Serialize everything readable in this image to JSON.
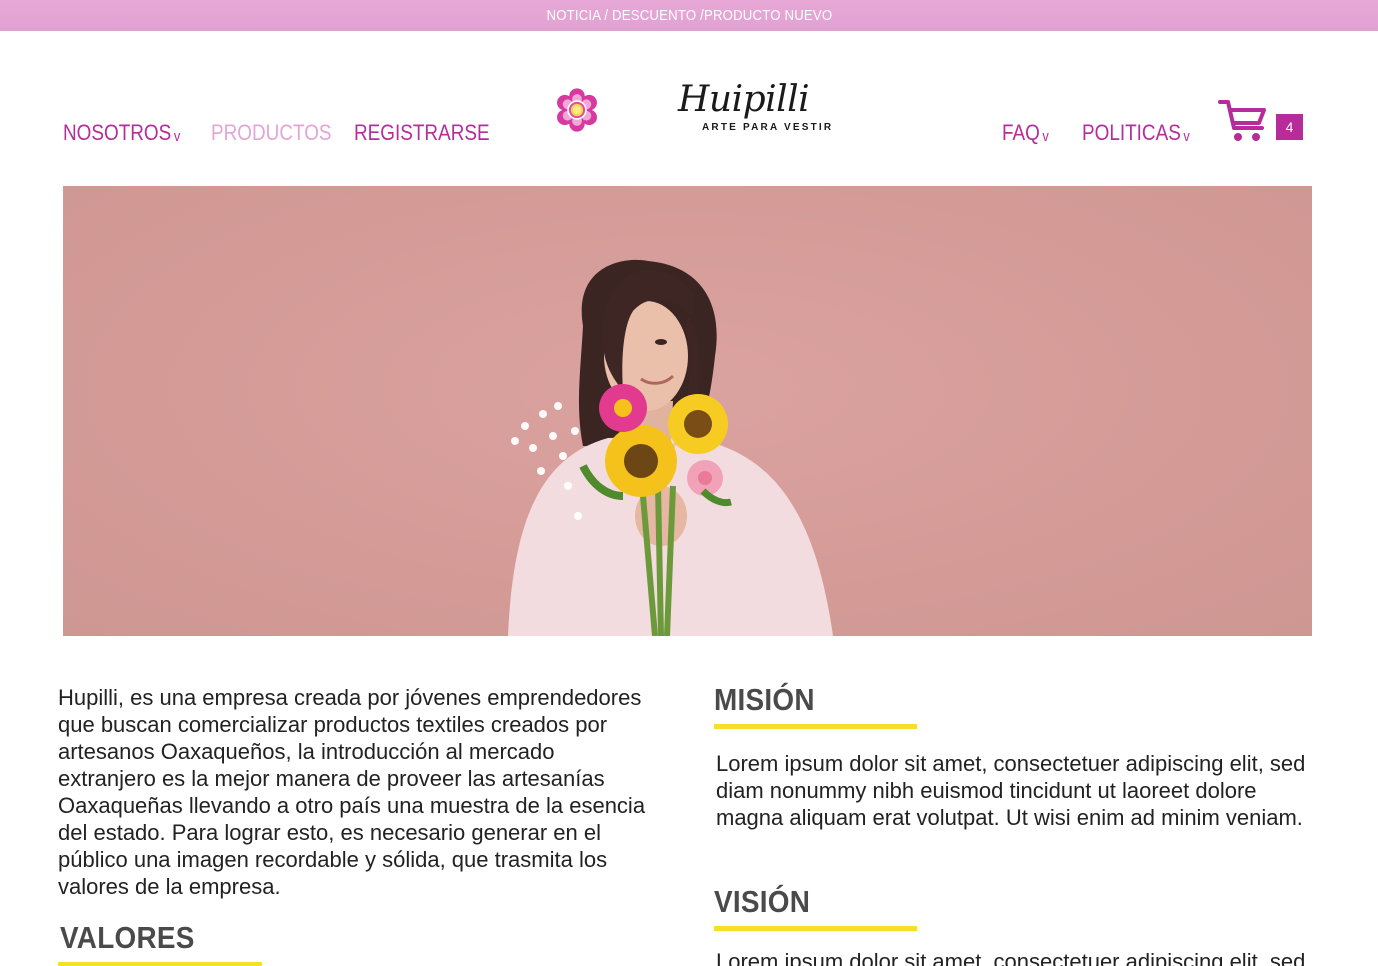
{
  "topbar": {
    "text": "NOTICIA / DESCUENTO /PRODUCTO NUEVO"
  },
  "nav": {
    "left": [
      {
        "label": "NOSOTROS",
        "chevron": "v"
      },
      {
        "label": "PRODUCTOS"
      },
      {
        "label": "REGISTRARSE"
      }
    ],
    "right": [
      {
        "label": "FAQ",
        "chevron": "v"
      },
      {
        "label": "POLITICAS",
        "chevron": "v"
      }
    ]
  },
  "brand": {
    "name": "Huipilli",
    "tagline": "ARTE PARA VESTIR"
  },
  "cart": {
    "count": "4",
    "icon": "cart-icon"
  },
  "intro": {
    "text": "Hupilli, es una empresa creada por jóvenes emprendedores que buscan comercializar productos textiles creados por artesanos Oaxaqueños, la introducción al mercado extranjero es la mejor manera de proveer las artesanías Oaxaqueñas llevando a otro país una muestra de la esencia del estado. Para lograr esto, es necesario generar en el público una imagen recordable y sólida, que trasmita los valores de la empresa."
  },
  "sections": {
    "mision": {
      "title": "MISIÓN",
      "text": "Lorem ipsum dolor sit amet, consectetuer adipiscing elit, sed diam nonummy nibh euismod tincidunt ut laoreet dolore magna aliquam erat volutpat. Ut wisi enim ad minim veniam."
    },
    "vision": {
      "title": "VISIÓN",
      "text": "Lorem ipsum dolor sit amet, consectetuer adipiscing elit, sed"
    },
    "valores": {
      "title": "VALORES"
    }
  },
  "colors": {
    "accent": "#b62c9b",
    "accent_light": "#e2a5d6",
    "topbar": "#e3a6d4",
    "underline": "#f6de2b",
    "hero_bg": "#d49b97"
  }
}
